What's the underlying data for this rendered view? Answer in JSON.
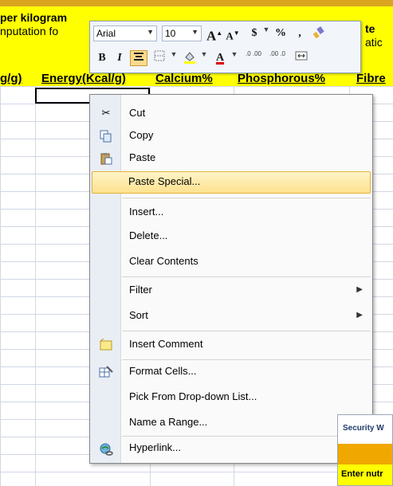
{
  "header": {
    "line1": "per kilogram",
    "line2": "nputation fo",
    "right1": "te",
    "right2": "atic"
  },
  "column_headers": [
    "g/g)",
    "Energy(Kcal/g)",
    "Calcium%",
    "Phosphorous%",
    "Fibre"
  ],
  "mini_toolbar": {
    "font_name": "Arial",
    "font_size": "10",
    "grow_font": "A",
    "shrink_font": "A",
    "currency": "$",
    "percent": "%",
    "comma": ",",
    "bold": "B",
    "italic": "I",
    "inc_decimal": ".0 .00",
    "dec_decimal": ".00 .0"
  },
  "context_menu": {
    "items": [
      {
        "label": "Cut",
        "icon": "scissors-icon"
      },
      {
        "label": "Copy",
        "icon": "copy-icon"
      },
      {
        "label": "Paste",
        "icon": "paste-icon"
      },
      {
        "label": "Paste Special...",
        "icon": ""
      },
      {
        "label": "Insert...",
        "icon": ""
      },
      {
        "label": "Delete...",
        "icon": ""
      },
      {
        "label": "Clear Contents",
        "icon": ""
      },
      {
        "label": "Filter",
        "icon": ""
      },
      {
        "label": "Sort",
        "icon": ""
      },
      {
        "label": "Insert Comment",
        "icon": "comment-icon"
      },
      {
        "label": "Format Cells...",
        "icon": "format-cells-icon"
      },
      {
        "label": "Pick From Drop-down List...",
        "icon": ""
      },
      {
        "label": "Name a Range...",
        "icon": ""
      },
      {
        "label": "Hyperlink...",
        "icon": "hyperlink-icon"
      }
    ],
    "highlighted": "Paste Special..."
  },
  "security_window": {
    "title": "Security W",
    "body": "Enter nutr"
  },
  "colors": {
    "header_yellow": "#ffff00",
    "band_orange": "#d9a520",
    "menu_highlight": "#fde28e",
    "menu_border": "#868686"
  }
}
